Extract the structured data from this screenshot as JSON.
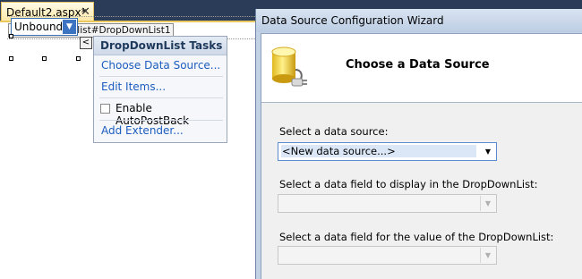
{
  "designer": {
    "tab_title": "Default2.aspx*",
    "tab_close": "✕",
    "control_tag": "asp:dropdownlist#DropDownList1",
    "dropdown_value": "Unbound",
    "smart_tag_glyph": "<"
  },
  "tasks_panel": {
    "title": "DropDownList Tasks",
    "choose_data_source": "Choose Data Source...",
    "edit_items": "Edit Items...",
    "enable_autopostback": "Enable AutoPostBack",
    "autopostback_checked": false,
    "add_extender": "Add Extender..."
  },
  "wizard": {
    "title": "Data Source Configuration Wizard",
    "heading": "Choose a Data Source",
    "icon": "database-plug-icon",
    "select_source_label": "Select a data source:",
    "select_source_value": "<New data source...>",
    "display_field_label": "Select a data field to display in the DropDownList:",
    "display_field_value": "",
    "value_field_label": "Select a data field for the value of the DropDownList:",
    "value_field_value": ""
  }
}
